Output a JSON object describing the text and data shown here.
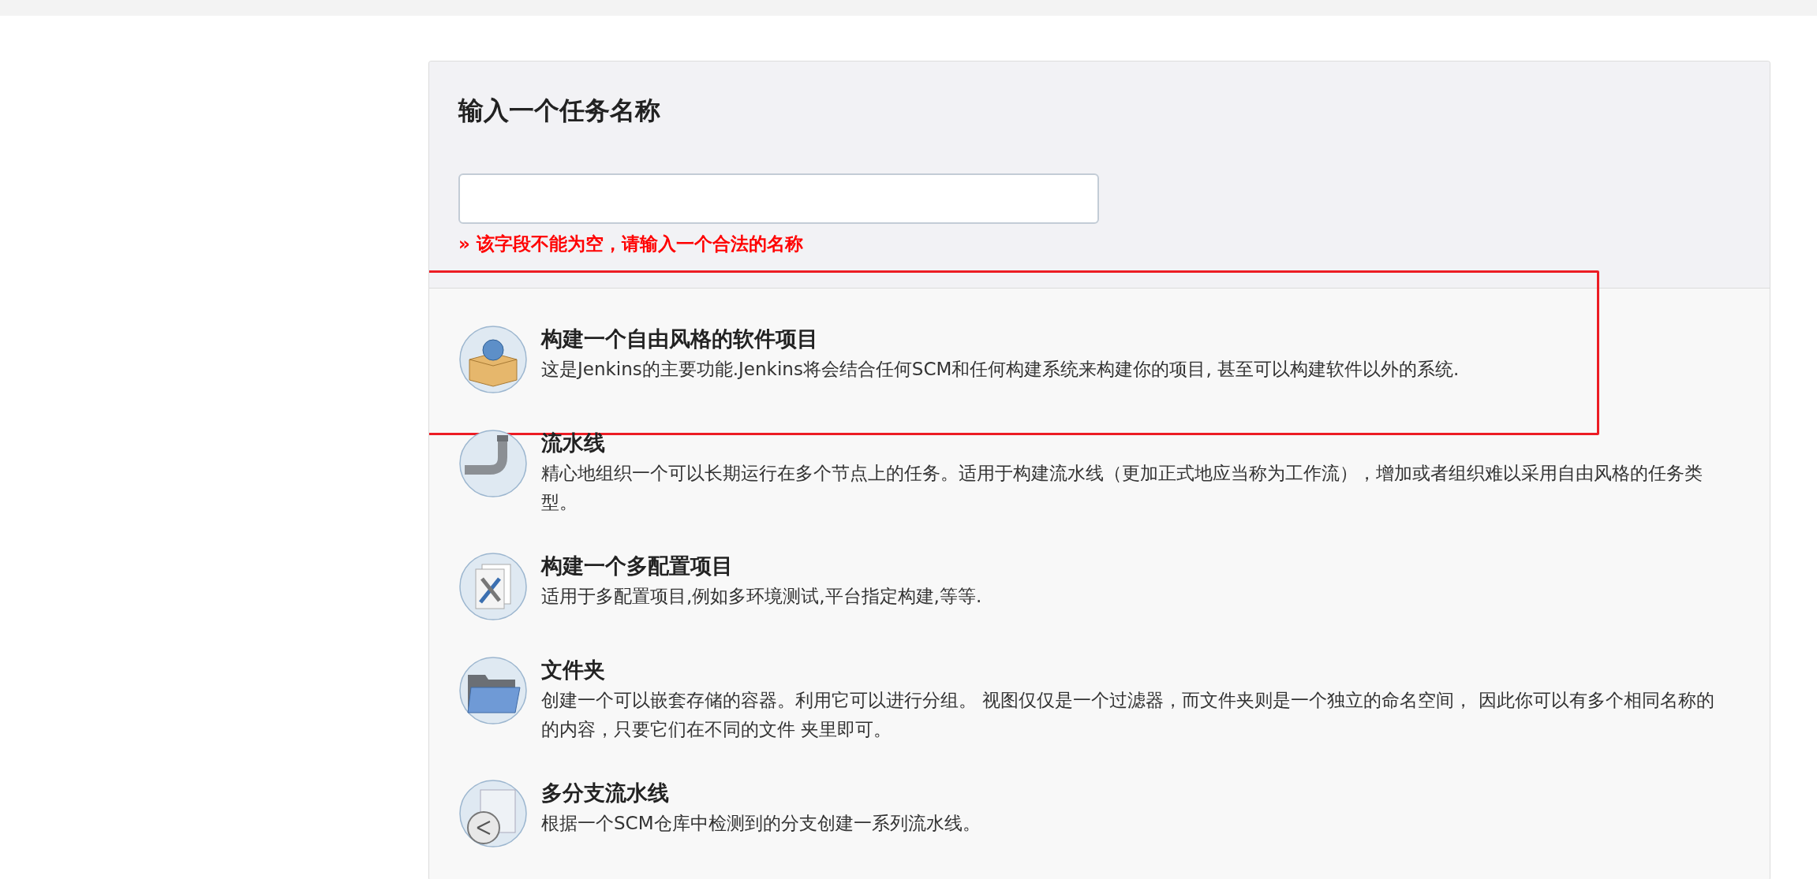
{
  "form": {
    "title": "输入一个任务名称",
    "error": "» 该字段不能为空，请输入一个合法的名称"
  },
  "item_types": [
    {
      "kind": "freestyle",
      "title": "构建一个自由风格的软件项目",
      "description": "这是Jenkins的主要功能.Jenkins将会结合任何SCM和任何构建系统来构建你的项目, 甚至可以构建软件以外的系统.",
      "highlighted": true
    },
    {
      "kind": "pipeline",
      "title": "流水线",
      "description": "精心地组织一个可以长期运行在多个节点上的任务。适用于构建流水线（更加正式地应当称为工作流），增加或者组织难以采用自由风格的任务类型。",
      "highlighted": false
    },
    {
      "kind": "multiconfig",
      "title": "构建一个多配置项目",
      "description": "适用于多配置项目,例如多环境测试,平台指定构建,等等.",
      "highlighted": false
    },
    {
      "kind": "folder",
      "title": "文件夹",
      "description": "创建一个可以嵌套存储的容器。利用它可以进行分组。 视图仅仅是一个过滤器，而文件夹则是一个独立的命名空间， 因此你可以有多个相同名称的的内容，只要它们在不同的文件 夹里即可。",
      "highlighted": false
    },
    {
      "kind": "multibranch",
      "title": "多分支流水线",
      "description": "根据一个SCM仓库中检测到的分支创建一系列流水线。",
      "highlighted": false
    }
  ]
}
